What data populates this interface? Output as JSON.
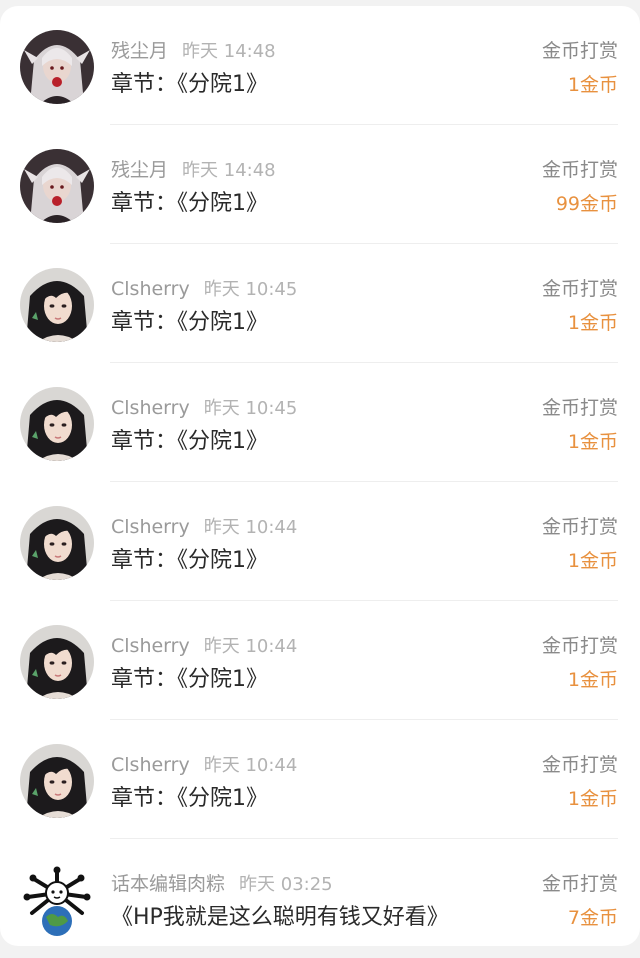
{
  "records": [
    {
      "username": "残尘月",
      "time": "昨天 14:48",
      "content": "章节：《分院1》",
      "type": "金币打赏",
      "amount": "1金币",
      "avatar_icon": "silver-hair-girl-avatar"
    },
    {
      "username": "残尘月",
      "time": "昨天 14:48",
      "content": "章节：《分院1》",
      "type": "金币打赏",
      "amount": "99金币",
      "avatar_icon": "silver-hair-girl-avatar"
    },
    {
      "username": "Clsherry",
      "time": "昨天 10:45",
      "content": "章节：《分院1》",
      "type": "金币打赏",
      "amount": "1金币",
      "avatar_icon": "dark-hair-girl-avatar"
    },
    {
      "username": "Clsherry",
      "time": "昨天 10:45",
      "content": "章节：《分院1》",
      "type": "金币打赏",
      "amount": "1金币",
      "avatar_icon": "dark-hair-girl-avatar"
    },
    {
      "username": "Clsherry",
      "time": "昨天 10:44",
      "content": "章节：《分院1》",
      "type": "金币打赏",
      "amount": "1金币",
      "avatar_icon": "dark-hair-girl-avatar"
    },
    {
      "username": "Clsherry",
      "time": "昨天 10:44",
      "content": "章节：《分院1》",
      "type": "金币打赏",
      "amount": "1金币",
      "avatar_icon": "dark-hair-girl-avatar"
    },
    {
      "username": "Clsherry",
      "time": "昨天 10:44",
      "content": "章节：《分院1》",
      "type": "金币打赏",
      "amount": "1金币",
      "avatar_icon": "dark-hair-girl-avatar"
    },
    {
      "username": "话本编辑肉粽",
      "time": "昨天 03:25",
      "content": "《HP我就是这么聪明有钱又好看》",
      "type": "金币打赏",
      "amount": "7金币",
      "avatar_icon": "earth-creature-avatar"
    }
  ],
  "colors": {
    "amount": "#e8913f",
    "username": "#9a9a9a",
    "time": "#b3b3b3",
    "content": "#2a2a2a",
    "divider": "#eeeeee",
    "background": "#f2f2f2",
    "card": "#ffffff"
  }
}
